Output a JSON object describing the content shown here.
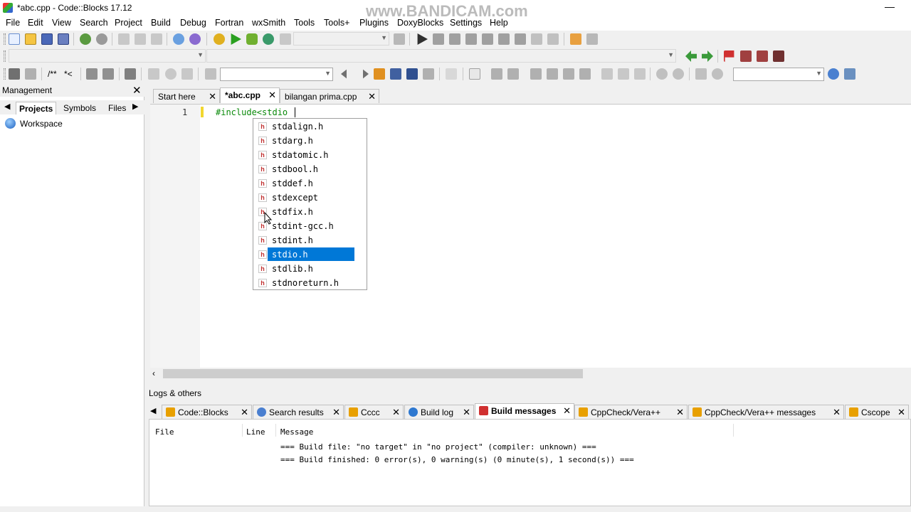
{
  "window": {
    "title": "*abc.cpp - Code::Blocks 17.12",
    "watermark": "www.BANDICAM.com",
    "minimize_glyph": "—"
  },
  "menu": [
    "File",
    "Edit",
    "View",
    "Search",
    "Project",
    "Build",
    "Debug",
    "Fortran",
    "wxSmith",
    "Tools",
    "Tools+",
    "Plugins",
    "DoxyBlocks",
    "Settings",
    "Help"
  ],
  "toolbar": {
    "comment_block": "/**",
    "comment_line": "*<"
  },
  "management": {
    "title": "Management",
    "close_glyph": "✕",
    "tabs": [
      {
        "label": "Projects",
        "active": true
      },
      {
        "label": "Symbols",
        "active": false
      },
      {
        "label": "Files",
        "active": false
      }
    ],
    "tree_root": "Workspace"
  },
  "editor": {
    "tabs": [
      {
        "label": "Start here",
        "active": false
      },
      {
        "label": "*abc.cpp",
        "active": true
      },
      {
        "label": "bilangan prima.cpp",
        "active": false
      }
    ],
    "line_number": "1",
    "code": "#include<stdio",
    "autocomplete": {
      "items": [
        "stdalign.h",
        "stdarg.h",
        "stdatomic.h",
        "stdbool.h",
        "stddef.h",
        "stdexcept",
        "stdfix.h",
        "stdint-gcc.h",
        "stdint.h",
        "stdio.h",
        "stdlib.h",
        "stdnoreturn.h"
      ],
      "selected_index": 9,
      "item_icon_glyph": "h"
    }
  },
  "logs": {
    "title": "Logs & others",
    "tabs": [
      {
        "label": "Code::Blocks",
        "active": false,
        "icon": "document-icon",
        "color": "#e8a000"
      },
      {
        "label": "Search results",
        "active": false,
        "icon": "search-icon",
        "color": "#4a7fd0"
      },
      {
        "label": "Cccc",
        "active": false,
        "icon": "document-icon",
        "color": "#e8a000"
      },
      {
        "label": "Build log",
        "active": false,
        "icon": "gear-icon",
        "color": "#2e78d0"
      },
      {
        "label": "Build messages",
        "active": true,
        "icon": "flag-icon",
        "color": "#d03030"
      },
      {
        "label": "CppCheck/Vera++",
        "active": false,
        "icon": "document-icon",
        "color": "#e8a000"
      },
      {
        "label": "CppCheck/Vera++ messages",
        "active": false,
        "icon": "document-icon",
        "color": "#e8a000"
      },
      {
        "label": "Cscope",
        "active": false,
        "icon": "document-icon",
        "color": "#e8a000"
      }
    ],
    "columns": [
      "File",
      "Line",
      "Message"
    ],
    "messages": [
      "=== Build file: \"no target\" in \"no project\" (compiler: unknown) ===",
      "=== Build finished: 0 error(s), 0 warning(s) (0 minute(s), 1 second(s)) ==="
    ]
  },
  "colors": {
    "accent_selection": "#0078d7",
    "code_preprocessor": "#0a8a0a",
    "change_marker": "#f2d730"
  }
}
